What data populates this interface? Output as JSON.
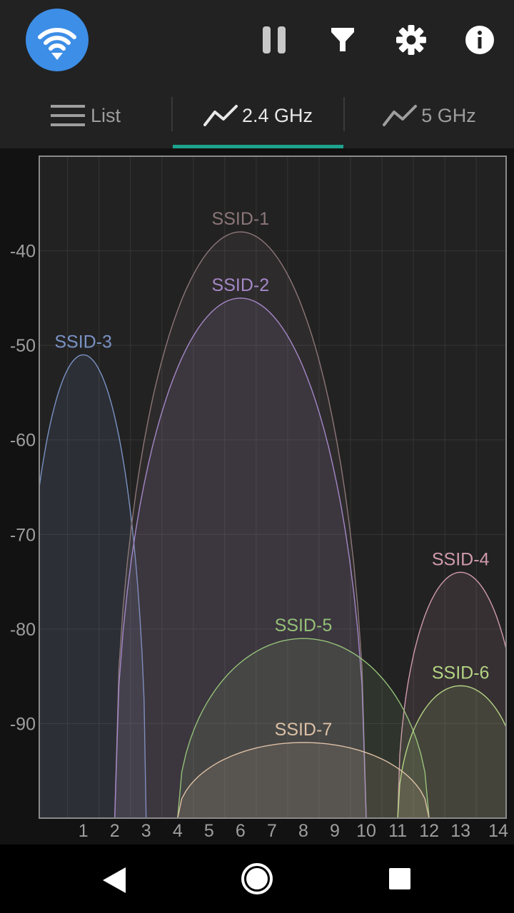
{
  "header": {
    "logo_icon": "wifi-icon",
    "actions": [
      {
        "name": "pause-button",
        "icon": "pause-icon"
      },
      {
        "name": "filter-button",
        "icon": "filter-icon"
      },
      {
        "name": "settings-button",
        "icon": "gear-icon"
      },
      {
        "name": "info-button",
        "icon": "info-icon"
      }
    ]
  },
  "tabs": [
    {
      "label": "List",
      "icon": "list-icon",
      "active": false
    },
    {
      "label": "2.4 GHz",
      "icon": "chart-line-icon",
      "active": true
    },
    {
      "label": "5 GHz",
      "icon": "chart-line-icon",
      "active": false
    }
  ],
  "colors": {
    "accent": "#1ea38e",
    "logo": "#3d8ee6"
  },
  "chart_data": {
    "type": "area",
    "title": "",
    "xlabel": "",
    "ylabel": "",
    "xlim": [
      -0.4,
      14.45
    ],
    "ylim": [
      -100,
      -30
    ],
    "x_ticks": [
      "1",
      "2",
      "3",
      "4",
      "5",
      "6",
      "7",
      "8",
      "9",
      "10",
      "11",
      "12",
      "13",
      "14"
    ],
    "x_tick_values": [
      1,
      2,
      3,
      4,
      5,
      6,
      7,
      8,
      9,
      10,
      11,
      12,
      13,
      14.2
    ],
    "y_ticks": [
      "-40",
      "-50",
      "-60",
      "-70",
      "-80",
      "-90"
    ],
    "y_tick_values": [
      -40,
      -50,
      -60,
      -70,
      -80,
      -90
    ],
    "grid": true,
    "series": [
      {
        "name": "SSID-3",
        "channel": 1,
        "width_channels": 4,
        "signal_dbm": -51,
        "color": "#7a92c4"
      },
      {
        "name": "SSID-1",
        "channel": 6,
        "width_channels": 8,
        "signal_dbm": -38,
        "color": "#8c7678"
      },
      {
        "name": "SSID-2",
        "channel": 6,
        "width_channels": 8,
        "signal_dbm": -45,
        "color": "#a488c8"
      },
      {
        "name": "SSID-4",
        "channel": 13,
        "width_channels": 4,
        "signal_dbm": -74,
        "color": "#d09aae"
      },
      {
        "name": "SSID-5",
        "channel": 8,
        "width_channels": 8,
        "signal_dbm": -81,
        "color": "#94c078"
      },
      {
        "name": "SSID-6",
        "channel": 13,
        "width_channels": 4,
        "signal_dbm": -86,
        "color": "#b4d484"
      },
      {
        "name": "SSID-7",
        "channel": 8,
        "width_channels": 8,
        "signal_dbm": -92,
        "color": "#dcc0a4"
      }
    ]
  },
  "navbar": {
    "buttons": [
      {
        "name": "back-button",
        "icon": "back-triangle-icon"
      },
      {
        "name": "home-button",
        "icon": "home-circle-icon"
      },
      {
        "name": "recents-button",
        "icon": "recents-square-icon"
      }
    ]
  }
}
